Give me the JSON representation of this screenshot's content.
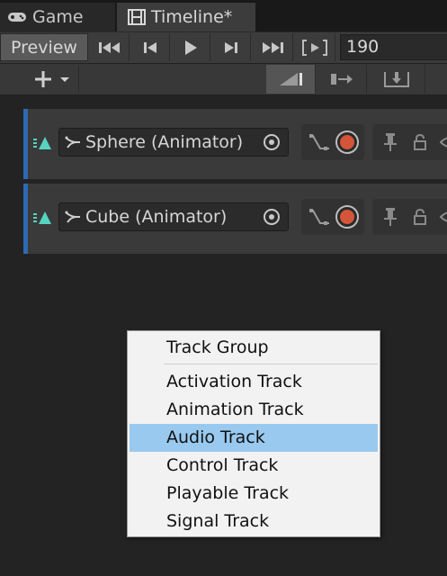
{
  "tabs": [
    {
      "label": "Game",
      "icon": "gamepad-icon"
    },
    {
      "label": "Timeline*",
      "icon": "film-icon"
    }
  ],
  "toolbar": {
    "preview_label": "Preview",
    "frame_value": "190"
  },
  "tracks": [
    {
      "name": "Sphere (Animator)"
    },
    {
      "name": "Cube (Animator)"
    }
  ],
  "menu": {
    "items": [
      "Track Group",
      "Activation Track",
      "Animation Track",
      "Audio Track",
      "Control Track",
      "Playable Track",
      "Signal Track"
    ],
    "selected": "Audio Track"
  },
  "colors": {
    "track_accent": "#2d6ab3",
    "record": "#d4553a",
    "menu_highlight": "#99c9ef",
    "track_icon": "#55d4c0"
  }
}
